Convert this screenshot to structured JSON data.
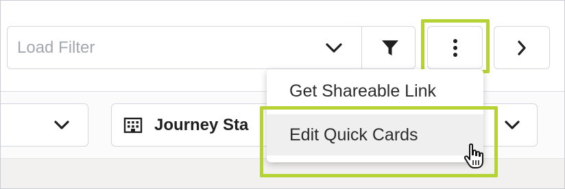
{
  "filter_bar": {
    "load_filter_placeholder": "Load Filter",
    "dropdown_icon": "chevron-down-icon",
    "filter_icon": "funnel-icon",
    "more_icon": "vertical-ellipsis-icon",
    "next_icon": "chevron-right-icon"
  },
  "selectors": {
    "journey_selector_label": "Journey Sta",
    "journey_icon": "building-icon"
  },
  "menu": {
    "items": [
      {
        "label": "Get Shareable Link"
      },
      {
        "label": "Edit Quick Cards",
        "hovered": true
      }
    ]
  },
  "colors": {
    "highlight": "#b5d334",
    "border": "#d3d6db",
    "placeholder": "#a3a8b0",
    "hover_bg": "#efefef"
  }
}
